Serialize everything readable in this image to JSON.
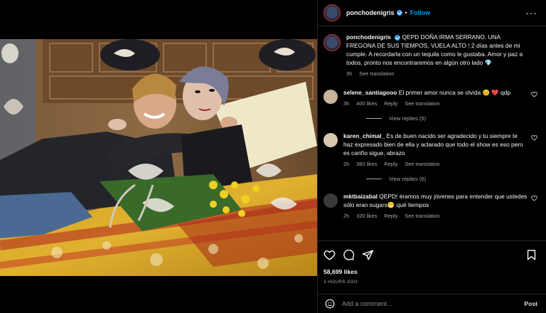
{
  "post": {
    "username": "ponchodenigris",
    "follow_label": "Follow",
    "more_icon": "more-horizontal-icon",
    "caption": {
      "username": "ponchodenigris",
      "text": "QEPD DOÑA IRMA SERRANO. UNA FREGONA DE SUS TIEMPOS, VUELA ALTO 🕯 2 días antes de mi cumple. A recordarla con un tequila como le gustaba. Amor y paz a todos, pronto nos encontraremos en algún otro lado 💎",
      "time": "3h",
      "see_translation": "See translation"
    }
  },
  "comments": [
    {
      "username": "selene_santiagooo",
      "text": "El primer amor nunca se olvida 😊 ❤️ qdp",
      "time": "3h",
      "likes": "400 likes",
      "reply": "Reply",
      "see_translation": "See translation",
      "view_replies": "View replies (5)",
      "avatar_color": "#c8b49a"
    },
    {
      "username": "karen_chimal_",
      "text": "Es de buen nacido ser agradecido y tu siempre te haz expresado bien de ella y aclarado que todo el show es eso pero es cariño sigue, abrazo",
      "time": "2h",
      "likes": "360 likes",
      "reply": "Reply",
      "see_translation": "See translation",
      "view_replies": "View replies (6)",
      "avatar_color": "#d8c8b0"
    },
    {
      "username": "mktbaizabal",
      "text": "QEPD🕯 éramos muy jóvenes para entender que ustedes sólo eran sugars😬 qué tiempos",
      "time": "2h",
      "likes": "320 likes",
      "reply": "Reply",
      "see_translation": "See translation",
      "avatar_color": "#3a3a3a"
    }
  ],
  "actions": {
    "likes": "58,699 likes",
    "time_ago": "3 HOURS AGO"
  },
  "add_comment": {
    "placeholder": "Add a comment...",
    "post_label": "Post"
  }
}
